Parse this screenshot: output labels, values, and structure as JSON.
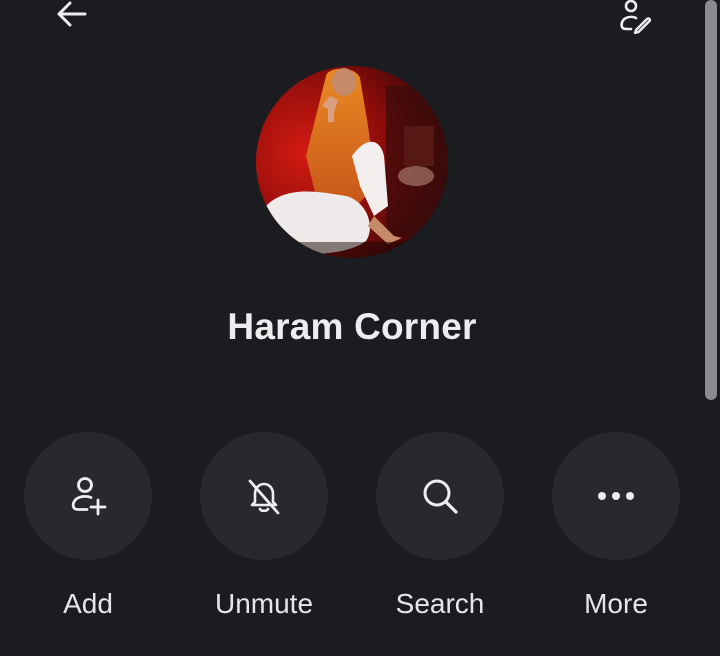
{
  "header": {
    "back_icon": "arrow-left-icon",
    "edit_icon": "user-edit-icon"
  },
  "profile": {
    "name": "Haram Corner",
    "avatar_description_icon": "profile-photo"
  },
  "actions": [
    {
      "label": "Add",
      "icon": "user-plus-icon"
    },
    {
      "label": "Unmute",
      "icon": "bell-off-icon"
    },
    {
      "label": "Search",
      "icon": "search-icon"
    },
    {
      "label": "More",
      "icon": "more-horizontal-icon"
    }
  ],
  "colors": {
    "background": "#1b1c20",
    "button_bg": "#27292d",
    "text": "#ececee",
    "scrollbar": "#8b8c90"
  }
}
